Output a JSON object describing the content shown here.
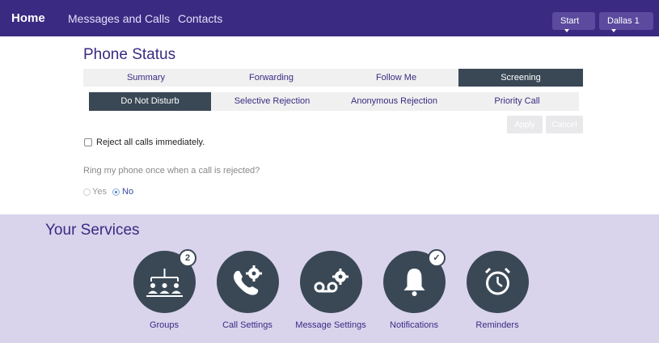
{
  "nav": {
    "home": "Home",
    "messages": "Messages and Calls",
    "contacts": "Contacts",
    "start": "Start",
    "account": "Dallas 1"
  },
  "phone_status": {
    "title": "Phone Status",
    "tabs": [
      {
        "label": "Summary",
        "active": false
      },
      {
        "label": "Forwarding",
        "active": false
      },
      {
        "label": "Follow Me",
        "active": false
      },
      {
        "label": "Screening",
        "active": true
      }
    ],
    "subtabs": [
      {
        "label": "Do Not Disturb",
        "active": true
      },
      {
        "label": "Selective Rejection",
        "active": false
      },
      {
        "label": "Anonymous Rejection",
        "active": false
      },
      {
        "label": "Priority Call",
        "active": false
      }
    ],
    "apply": "Apply",
    "cancel": "Cancel",
    "reject_label": "Reject all calls immediately.",
    "reject_checked": false,
    "ring_question": "Ring my phone once when a call is rejected?",
    "options": {
      "yes": "Yes",
      "no": "No"
    },
    "selected_option": "No"
  },
  "services": {
    "title": "Your Services",
    "items": [
      {
        "label": "Groups",
        "badge": "2",
        "icon": "groups-icon"
      },
      {
        "label": "Call Settings",
        "badge": "",
        "icon": "call-settings-icon"
      },
      {
        "label": "Message Settings",
        "badge": "",
        "icon": "voicemail-settings-icon"
      },
      {
        "label": "Notifications",
        "badge": "✓",
        "icon": "bell-icon"
      },
      {
        "label": "Reminders",
        "badge": "",
        "icon": "alarm-clock-icon"
      }
    ]
  },
  "colors": {
    "brand": "#3b2a82",
    "active_tab": "#3a4856",
    "services_bg": "#d9d4ec"
  }
}
